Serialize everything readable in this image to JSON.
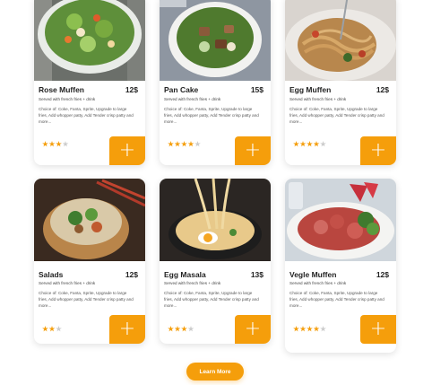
{
  "accent": "#f59e0b",
  "cards": [
    {
      "name": "Rose Muffen",
      "price": "12$",
      "subtitle": "Served with french fries + drink",
      "description": "Choice of: Coke, Fanta, Sprite, Upgrade to large fries, Add whopper patty, Add Tender crisp patty and more...",
      "rating": 3,
      "image": "salad-bowl-with-egg"
    },
    {
      "name": "Pan Cake",
      "price": "15$",
      "subtitle": "Served with french fries + drink",
      "description": "Choice of: Coke, Fanta, Sprite, Upgrade to large fries, Add whopper patty, Add Tender crisp patty and more...",
      "rating": 4,
      "image": "meat-and-greens-bowl"
    },
    {
      "name": "Egg Muffen",
      "price": "12$",
      "subtitle": "Served with french fries + drink",
      "description": "Choice of: Coke, Fanta, Sprite, Upgrade to large fries, Add whopper patty, Add Tender crisp patty and more...",
      "rating": 4,
      "image": "spaghetti-plate"
    },
    {
      "name": "Salads",
      "price": "12$",
      "subtitle": "Served with french fries + drink",
      "description": "Choice of: Coke, Fanta, Sprite, Upgrade to large fries, Add whopper patty, Add Tender crisp patty and more...",
      "rating": 2,
      "image": "rice-bowl-with-chopsticks"
    },
    {
      "name": "Egg Masala",
      "price": "13$",
      "subtitle": "Served with french fries + drink",
      "description": "Choice of: Coke, Fanta, Sprite, Upgrade to large fries, Add whopper patty, Add Tender crisp patty and more...",
      "rating": 3,
      "image": "noodle-pan-with-egg"
    },
    {
      "name": "Vegle Muffen",
      "price": "12$",
      "subtitle": "Served with french fries + drink",
      "description": "Choice of: Coke, Fanta, Sprite, Upgrade to large fries, Add whopper patty, Add Tender crisp patty and more...",
      "rating": 4,
      "image": "salami-greens-plate"
    }
  ],
  "add_button_icon": "plus-icon",
  "add_button_symbol": "+",
  "learn_more_label": "Learn More"
}
